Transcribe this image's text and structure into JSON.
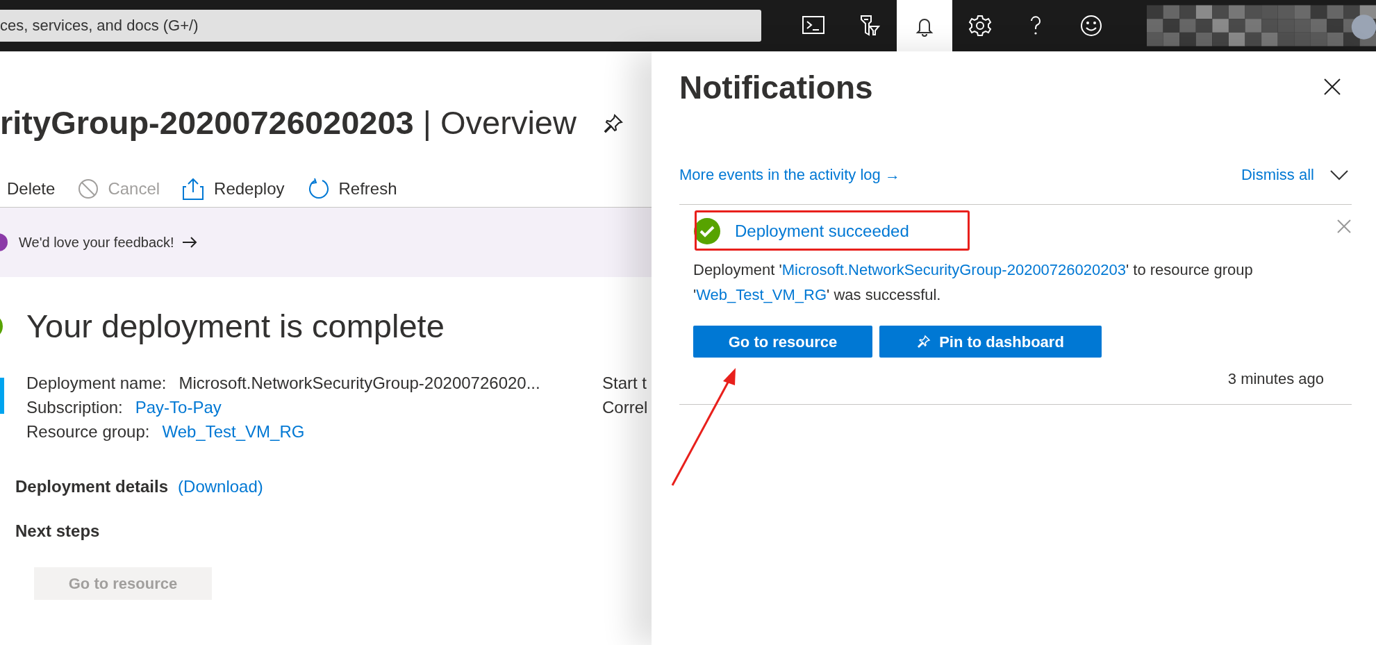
{
  "top_bar": {
    "search": {
      "placeholder": "ces, services, and docs (G+/)"
    },
    "icons": [
      {
        "kind": "terminal",
        "selected": false
      },
      {
        "kind": "filter",
        "selected": false
      },
      {
        "kind": "bell",
        "selected": true
      },
      {
        "kind": "gear",
        "selected": false
      },
      {
        "kind": "help",
        "selected": false
      },
      {
        "kind": "smiley",
        "selected": false
      }
    ]
  },
  "page": {
    "title": "**rityGroup-20200726020203** | Overview",
    "toolbar": [
      {
        "kind": "delete",
        "label": "Delete",
        "disabled": false
      },
      {
        "kind": "cancel",
        "label": "Cancel",
        "disabled": true
      },
      {
        "kind": "redeploy",
        "label": "Redeploy",
        "disabled": false
      },
      {
        "kind": "refresh",
        "label": "Refresh",
        "disabled": false
      }
    ],
    "feedback": "We'd love your feedback!",
    "heading": "Your deployment is complete",
    "details": [
      {
        "label": "Deployment name:",
        "value": "Microsoft.NetworkSecurityGroup-20200726020...",
        "link": false
      },
      {
        "label": "Subscription:",
        "value": "Pay-To-Pay",
        "link": true
      },
      {
        "label": "Resource group:",
        "value": "Web_Test_VM_RG",
        "link": true
      }
    ],
    "side_labels": [
      "Start t",
      "Correl"
    ],
    "details_heading": "Deployment details",
    "download": "(Download)",
    "next_steps": "Next steps",
    "next_button": {
      "label": "Go to resource",
      "disabled": true
    }
  },
  "notifications": {
    "title": "Notifications",
    "activity_link": "More events in the activity log →",
    "dismiss": "Dismiss all",
    "items": [
      {
        "kind": "success",
        "title": "Deployment succeeded",
        "message": [
          {
            "text": "Deployment '",
            "link": false
          },
          {
            "text": "Microsoft.NetworkSecurityGroup-20200726020203",
            "link": true
          },
          {
            "text": "' to resource group '",
            "link": false
          },
          {
            "text": "Web_Test_VM_RG",
            "link": true
          },
          {
            "text": "' was successful.",
            "link": false
          }
        ],
        "buttons": [
          {
            "label": "Go to resource",
            "kind": "plain"
          },
          {
            "label": "Pin to dashboard",
            "kind": "pinned"
          }
        ],
        "time": "3 minutes ago"
      }
    ]
  }
}
